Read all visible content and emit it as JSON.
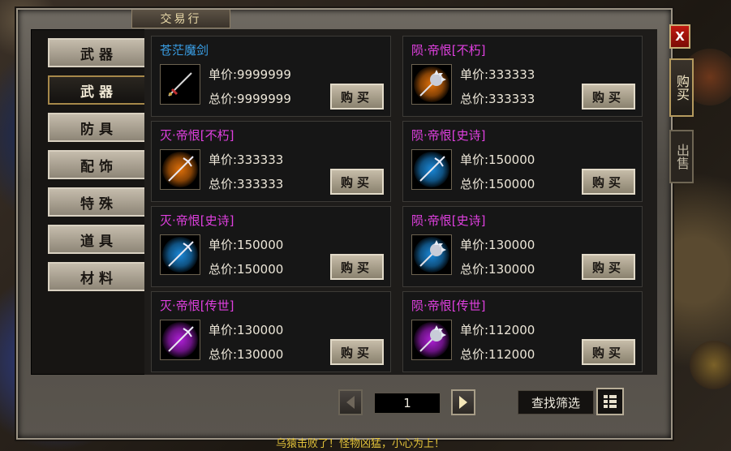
{
  "window": {
    "title": "交易行",
    "close_label": "X"
  },
  "side_tabs": [
    {
      "label": "购买"
    },
    {
      "label": "出售"
    }
  ],
  "categories": [
    {
      "label": "武器"
    },
    {
      "label": "武器"
    },
    {
      "label": "防具"
    },
    {
      "label": "配饰"
    },
    {
      "label": "特殊"
    },
    {
      "label": "道具"
    },
    {
      "label": "材料"
    }
  ],
  "active_category_index": 1,
  "items": [
    {
      "name": "苍茫魔剑",
      "name_color": "#3aa0e8",
      "unit_price": "单价:9999999",
      "total_price": "总价:9999999",
      "buy_label": "购买",
      "icon": "sword-icon",
      "glow": "#000000"
    },
    {
      "name": "陨·帝恨[不朽]",
      "name_color": "#e040e0",
      "unit_price": "单价:333333",
      "total_price": "总价:333333",
      "buy_label": "购买",
      "icon": "spiked-mace-icon",
      "glow": "#e0700a"
    },
    {
      "name": "灭·帝恨[不朽]",
      "name_color": "#e040e0",
      "unit_price": "单价:333333",
      "total_price": "总价:333333",
      "buy_label": "购买",
      "icon": "trident-icon",
      "glow": "#e0700a"
    },
    {
      "name": "陨·帝恨[史诗]",
      "name_color": "#e040e0",
      "unit_price": "单价:150000",
      "total_price": "总价:150000",
      "buy_label": "购买",
      "icon": "trident-icon",
      "glow": "#1a88d8"
    },
    {
      "name": "灭·帝恨[史诗]",
      "name_color": "#e040e0",
      "unit_price": "单价:150000",
      "total_price": "总价:150000",
      "buy_label": "购买",
      "icon": "trident-icon",
      "glow": "#1a88d8"
    },
    {
      "name": "陨·帝恨[史诗]",
      "name_color": "#e040e0",
      "unit_price": "单价:130000",
      "total_price": "总价:130000",
      "buy_label": "购买",
      "icon": "spiked-mace-icon",
      "glow": "#1a88d8"
    },
    {
      "name": "灭·帝恨[传世]",
      "name_color": "#e040e0",
      "unit_price": "单价:130000",
      "total_price": "总价:130000",
      "buy_label": "购买",
      "icon": "trident-icon",
      "glow": "#b020d8"
    },
    {
      "name": "陨·帝恨[传世]",
      "name_color": "#e040e0",
      "unit_price": "单价:112000",
      "total_price": "总价:112000",
      "buy_label": "购买",
      "icon": "spiked-mace-icon",
      "glow": "#b020d8"
    }
  ],
  "pager": {
    "current_page": "1"
  },
  "filter": {
    "label": "查找筛选"
  },
  "chat": {
    "message": "乌猿击败了！怪物凶猛，小心为上！"
  }
}
